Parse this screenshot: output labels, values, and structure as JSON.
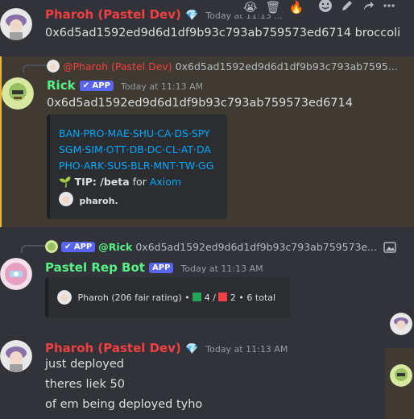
{
  "toolbar": {
    "reactions": [
      "😭",
      "🗑",
      "🔥"
    ],
    "icons": [
      "add-reaction-icon",
      "edit-icon",
      "forward-icon",
      "more-icon"
    ]
  },
  "messages": [
    {
      "username": "Pharoh (Pastel Dev)",
      "role_icon": "💎",
      "timestamp": "Today at 11:13 ...",
      "lines": [
        "0x6d5ad1592ed9d6d1df9b93c793ab759573ed6714 broccoli"
      ],
      "name_color": "#f23f43"
    },
    {
      "reply": {
        "mention": "@Pharoh (Pastel Dev)",
        "text": "0x6d5ad1592ed9d6d1df9b93c793ab7595..."
      },
      "username": "Rick",
      "badge": "✔ APP",
      "timestamp": "Today at 11:13 AM",
      "lines": [
        "0x6d5ad1592ed9d6d1df9b93c793ab759573ed6714"
      ],
      "name_color": "#57f287",
      "embed": {
        "link_lines": [
          "BAN·PRO·MAE·SHU·CA·DS·SPY",
          "SGM·SIM·OTT·DB·DC·CL·AT·DA",
          "PHO·ARK·SUS·BLR·MNT·TW·GG"
        ],
        "tip_icon": "🌱",
        "tip_bold": "TIP: /beta",
        "tip_for": "for",
        "tip_link": "Axiom",
        "footer": "pharoh."
      }
    },
    {
      "reply": {
        "badge": "✔ APP",
        "mention": "@Rick",
        "text": "0x6d5ad1592ed9d6d1df9b93c793ab759573e..."
      },
      "username": "Pastel Rep Bot",
      "badge": "APP",
      "timestamp": "Today at 11:13 AM",
      "name_color": "#57f287",
      "embed": {
        "text": "Pharoh (206 fair rating)",
        "sep1": "•",
        "green_count": "4",
        "slash": "/",
        "red_count": "2",
        "sep2": "•",
        "total": "6 total"
      }
    },
    {
      "username": "Pharoh (Pastel Dev)",
      "role_icon": "💎",
      "timestamp": "Today at 11:13 AM",
      "lines": [
        "just deployed",
        "theres liek 50",
        "of em being deployed tyho"
      ],
      "name_color": "#f23f43"
    }
  ]
}
